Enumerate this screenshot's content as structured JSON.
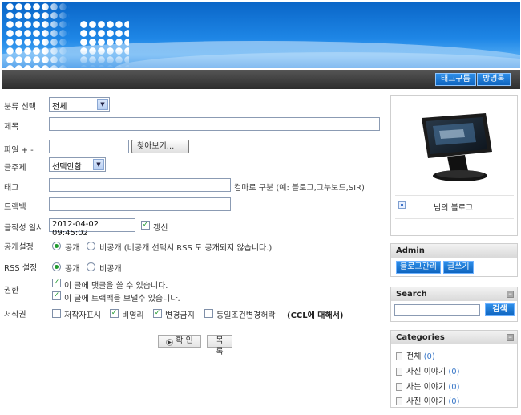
{
  "nav": {
    "tags_label": "태그구름",
    "guestbook_label": "방명록"
  },
  "form": {
    "category_label": "분류 선택",
    "category_value": "전체",
    "title_label": "제목",
    "title_value": "",
    "file_label": "파일 + -",
    "file_button": "찾아보기...",
    "topic_label": "글주제",
    "topic_value": "선택안함",
    "tag_label": "태그",
    "tag_hint": "컴마로 구분 (예: 블로그,그누보드,SIR)",
    "trackback_label": "트랙백",
    "datetime_label": "글작성 일시",
    "datetime_value": "2012-04-02 09:45:02",
    "update_label": "갱신",
    "visibility_label": "공개설정",
    "visibility_public": "공개",
    "visibility_private": "비공개 (비공개 선택시 RSS 도 공개되지 않습니다.)",
    "rss_label": "RSS 설정",
    "rss_public": "공개",
    "rss_private": "비공개",
    "permission_label": "권한",
    "perm_comment": "이 글에 댓글을 쓸 수 있습니다.",
    "perm_trackback": "이 글에 트랙백을 보낼수 있습니다.",
    "copyright_label": "저작권",
    "cc_attribution": "저작자표시",
    "cc_noncommercial": "비영리",
    "cc_noderivs": "변경금지",
    "cc_sharealike": "동일조건변경허락",
    "ccl_link": "(CCL에 대해서)",
    "confirm_button": "확 인",
    "list_button": "목록"
  },
  "sidebar": {
    "profile_name": "님의 블로그",
    "admin_title": "Admin",
    "admin_manage": "블로그관리",
    "admin_write": "글쓰기",
    "search_title": "Search",
    "search_button": "검색",
    "search_value": "",
    "categories_title": "Categories",
    "categories": [
      {
        "name": "전체",
        "count": "(0)"
      },
      {
        "name": "사진 이야기",
        "count": "(0)"
      },
      {
        "name": "사는 이야기",
        "count": "(0)"
      },
      {
        "name": "사진 이야기",
        "count": "(0)"
      }
    ]
  }
}
